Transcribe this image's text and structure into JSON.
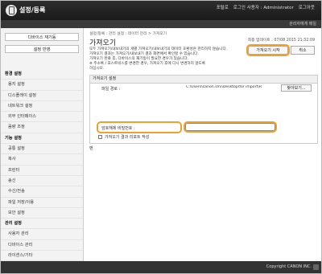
{
  "header": {
    "app_title": "설정/등록",
    "nav": [
      "포털로",
      "로그인 사용자 : Administrator",
      "로그아웃"
    ],
    "admin_link": "관리자에게 메일"
  },
  "sidebar": {
    "button_top": "디바이스 재기동",
    "button_apply": "설정 반영",
    "items": [
      {
        "label": "환경 설정",
        "type": "header"
      },
      {
        "label": "용지 설정",
        "type": "item"
      },
      {
        "label": "디스플레이 설정",
        "type": "item"
      },
      {
        "label": "네트워크 설정",
        "type": "item"
      },
      {
        "label": "외부 인터페이스",
        "type": "item"
      },
      {
        "label": "음량 조정",
        "type": "item"
      },
      {
        "label": "기능 설정",
        "type": "header"
      },
      {
        "label": "공통 설정",
        "type": "item"
      },
      {
        "label": "복사",
        "type": "item"
      },
      {
        "label": "프린터",
        "type": "item"
      },
      {
        "label": "송신",
        "type": "item"
      },
      {
        "label": "수신/전송",
        "type": "item"
      },
      {
        "label": "파일 저장/이용",
        "type": "item"
      },
      {
        "label": "보안 설정",
        "type": "item"
      },
      {
        "label": "관리 설정",
        "type": "header"
      },
      {
        "label": "사용자 관리",
        "type": "item"
      },
      {
        "label": "디바이스 관리",
        "type": "item"
      },
      {
        "label": "라이센스/기타",
        "type": "item"
      },
      {
        "label": "데이터 관리",
        "type": "item",
        "active": true
      },
      {
        "label": "보안 설정",
        "type": "item"
      }
    ]
  },
  "main": {
    "breadcrumb": "설정/등록 : 관리 설정 : 데이터 관리 > 가져오기",
    "title": "가져오기",
    "updated": "최종 업데이트 : 07/08 2015 21:32:09",
    "description": [
      "모두 가져오기/내보내기의 개별 가져오기/내보내기의 데이터 호환성은 관리하지 않습니다.",
      "가져오기 결과는 가져오기/내보내기 결과 화면에서 확인할 수 있습니다.",
      "가져오기 완료 후, 디바이스의 재기동이 필요한 경우가 있습니다.",
      "※ 주소록 / 포스트박스를 변경한 경우, 가져오기 후에 다시 변경하지 않도록",
      "하십시오."
    ],
    "import_button": "가져오기 시작",
    "cancel_button": "취소",
    "section": {
      "header": "가져오기 설정",
      "file_label": "파일 경로 :",
      "file_path": "C:\\Users\\canon.smi\\Desktop\\for import\\R",
      "browse_button": "찾아보기...",
      "password_label": "암호해제 비밀번호 :",
      "password_value": "",
      "checkbox_label": "가져오기 결과 리포트 작성"
    },
    "top_link": "맨"
  },
  "footer": {
    "copyright": "Copyright CANON INC."
  },
  "colors": {
    "highlight": "#f0a030",
    "topbar": "#222222"
  }
}
